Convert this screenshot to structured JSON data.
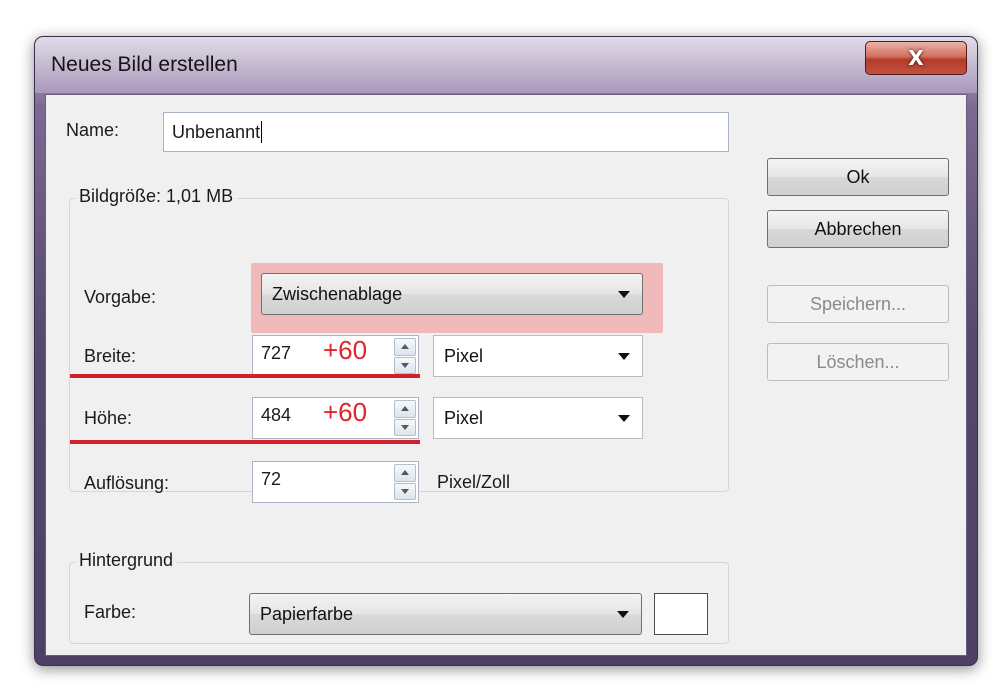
{
  "window": {
    "title": "Neues Bild erstellen",
    "close_label": "X"
  },
  "name_row": {
    "label": "Name:",
    "value": "Unbenannt"
  },
  "image_size": {
    "label": "Bildgröße: 1,01 MB",
    "preset": {
      "label": "Vorgabe:",
      "value": "Zwischenablage"
    },
    "width": {
      "label": "Breite:",
      "value": "727",
      "annotation": "+60",
      "unit": "Pixel"
    },
    "height": {
      "label": "Höhe:",
      "value": "484",
      "annotation": "+60",
      "unit": "Pixel"
    },
    "resolution": {
      "label": "Auflösung:",
      "value": "72",
      "unit": "Pixel/Zoll"
    }
  },
  "background": {
    "label": "Hintergrund",
    "color": {
      "label": "Farbe:",
      "value": "Papierfarbe",
      "swatch": "#ffffff"
    }
  },
  "buttons": {
    "ok": "Ok",
    "cancel": "Abbrechen",
    "save": "Speichern...",
    "delete": "Löschen..."
  },
  "colors": {
    "annotation": "#e0252b",
    "highlight": "#f0a0a0",
    "close_button": "#c7432f"
  }
}
